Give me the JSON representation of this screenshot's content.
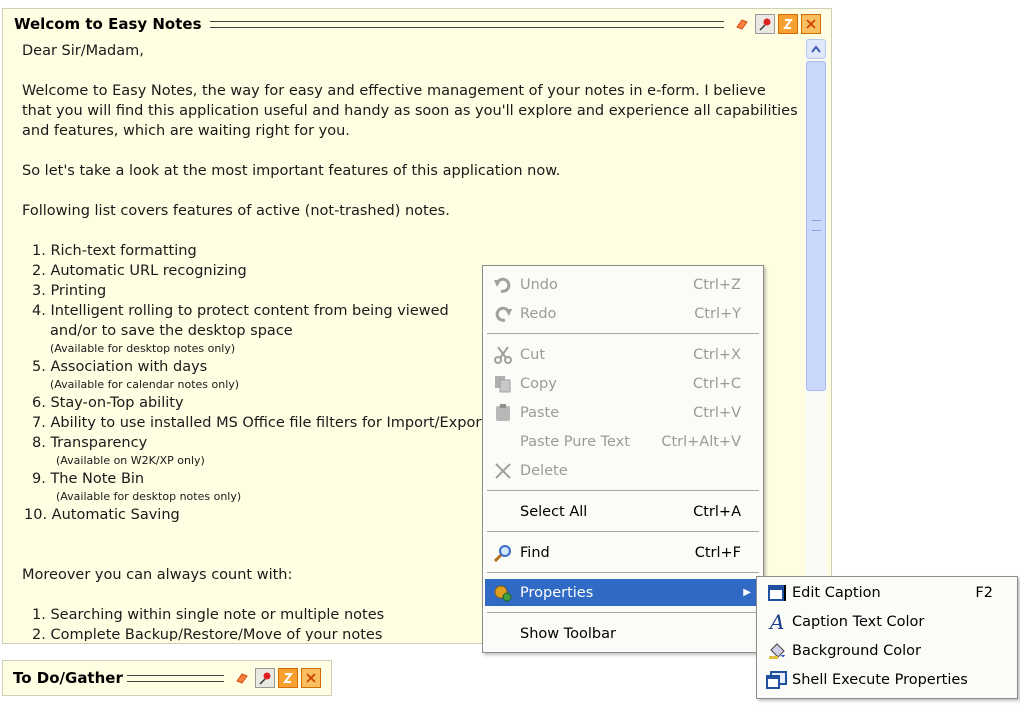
{
  "note_main": {
    "title": "Welcom to Easy Notes",
    "icons": [
      "eraser-icon",
      "pin-icon",
      "roll-icon",
      "close-icon"
    ],
    "greeting": "Dear Sir/Madam,",
    "intro1": "Welcome to Easy Notes, the way for easy and effective management of your notes in e-form. I believe",
    "intro2": "that you will find this application useful and handy as soon as you'll explore and experience all capabilities",
    "intro3": "and features, which are waiting right for you.",
    "lookline": "So let's take a look at the most important features of this application now.",
    "listhead": "Following list covers features of active (not-trashed) notes.",
    "features": {
      "f1": "1. Rich-text formatting",
      "f2": "2. Automatic URL recognizing",
      "f3": "3. Printing",
      "f4": "4. Intelligent rolling to protect content from being viewed",
      "f4b": "and/or to save the desktop space",
      "f4n": "(Available for desktop notes only)",
      "f5": "5. Association with days",
      "f5n": "(Available for calendar notes only)",
      "f6": "6. Stay-on-Top ability",
      "f7": "7. Ability to use installed MS Office file filters for Import/Export",
      "f8": "8. Transparency",
      "f8n": "(Available on W2K/XP only)",
      "f9": "9. The Note Bin",
      "f9n": "(Available for desktop notes only)",
      "f10": "10.  Automatic Saving"
    },
    "moreover": "Moreover you can always count with:",
    "extra1": "1. Searching within single note or multiple notes",
    "extra2": "2. Complete Backup/Restore/Move of your notes"
  },
  "note_second": {
    "title": "To Do/Gather"
  },
  "context_menu": {
    "undo": {
      "label": "Undo",
      "key": "Ctrl+Z"
    },
    "redo": {
      "label": "Redo",
      "key": "Ctrl+Y"
    },
    "cut": {
      "label": "Cut",
      "key": "Ctrl+X"
    },
    "copy": {
      "label": "Copy",
      "key": "Ctrl+C"
    },
    "paste": {
      "label": "Paste",
      "key": "Ctrl+V"
    },
    "paste_pure": {
      "label": "Paste Pure Text",
      "key": "Ctrl+Alt+V"
    },
    "delete": {
      "label": "Delete",
      "key": ""
    },
    "select_all": {
      "label": "Select All",
      "key": "Ctrl+A"
    },
    "find": {
      "label": "Find",
      "key": "Ctrl+F"
    },
    "properties": {
      "label": "Properties"
    },
    "show_toolbar": {
      "label": "Show Toolbar"
    }
  },
  "submenu": {
    "edit_caption": {
      "label": "Edit Caption",
      "key": "F2"
    },
    "caption_color": {
      "label": "Caption Text Color"
    },
    "bg_color": {
      "label": "Background Color"
    },
    "shell_exec": {
      "label": "Shell Execute Properties"
    }
  },
  "colors": {
    "note_bg": "#fffee3",
    "highlight": "#316ac5",
    "disabled_text": "#9a9a9a"
  }
}
